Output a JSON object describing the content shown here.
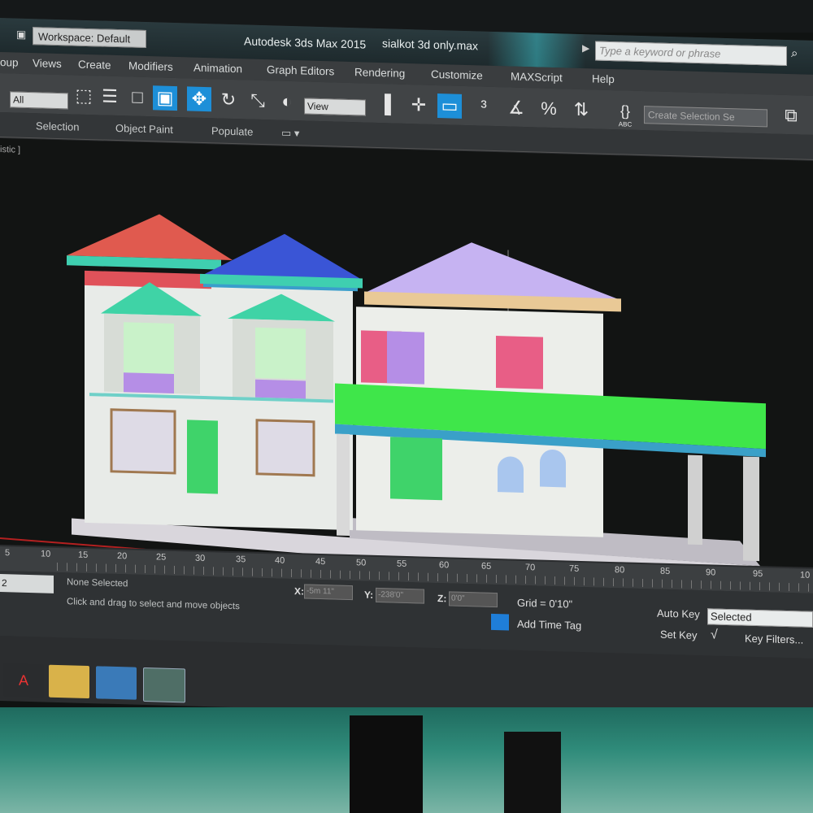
{
  "titlebar": {
    "workspace": "Workspace: Default",
    "app_title": "Autodesk 3ds Max  2015",
    "file_name": "sialkot 3d only.max",
    "search_placeholder": "Type a keyword or phrase"
  },
  "menu": {
    "items": [
      "oup",
      "Views",
      "Create",
      "Modifiers",
      "Animation",
      "Graph Editors",
      "Rendering",
      "Customize",
      "MAXScript",
      "Help"
    ]
  },
  "toolbar": {
    "filter_value": "All",
    "ref_coord_value": "View",
    "named_selection_placeholder": "Create Selection Se",
    "abc_label": "ABC"
  },
  "ribbon": {
    "tabs": [
      "Selection",
      "Object Paint",
      "Populate"
    ]
  },
  "viewport": {
    "label": "istic ]"
  },
  "timeline": {
    "frames": [
      "5",
      "10",
      "15",
      "20",
      "25",
      "30",
      "35",
      "40",
      "45",
      "50",
      "55",
      "60",
      "65",
      "70",
      "75",
      "80",
      "85",
      "90",
      "95",
      "10"
    ],
    "counter": "2"
  },
  "status": {
    "selection": "None Selected",
    "prompt": "Click and drag to select and move objects",
    "x_label": "X:",
    "x_value": "-5m 11\"",
    "y_label": "Y:",
    "y_value": "-238'0\"",
    "z_label": "Z:",
    "z_value": "0'0\"",
    "grid": "Grid = 0'10\"",
    "add_time_tag": "Add Time Tag",
    "auto_key": "Auto Key",
    "auto_key_mode": "Selected",
    "set_key": "Set Key",
    "key_filters": "Key Filters..."
  },
  "colors": {
    "accent_blue": "#1d8fd8",
    "roof_red": "#e05a4f",
    "roof_blue": "#3a55d6",
    "roof_lavender": "#c6b3f2",
    "roof_teal": "#3fd3a6",
    "canopy_green": "#3fe64a",
    "wall": "#e9ecea"
  }
}
